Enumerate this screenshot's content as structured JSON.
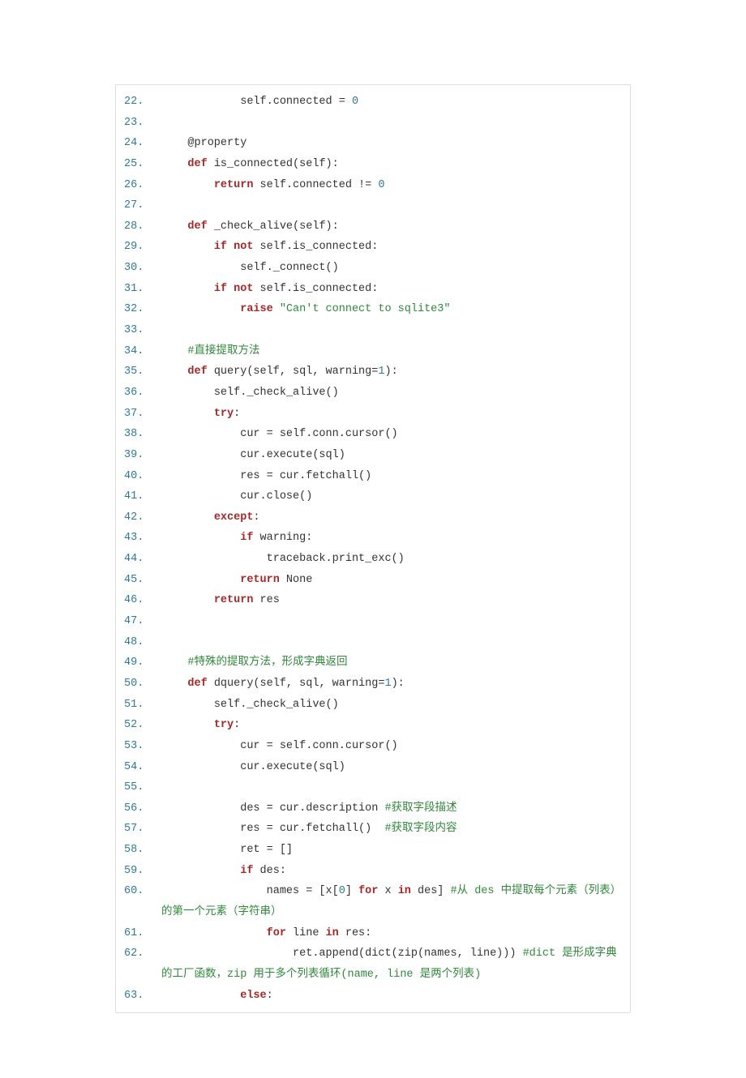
{
  "code": {
    "start": 22,
    "lines": [
      {
        "n": 22,
        "segs": [
          {
            "t": "            self.connected = "
          },
          {
            "t": "0",
            "c": "num"
          }
        ]
      },
      {
        "n": 23,
        "segs": []
      },
      {
        "n": 24,
        "segs": [
          {
            "t": "    @property"
          }
        ]
      },
      {
        "n": 25,
        "segs": [
          {
            "t": "    "
          },
          {
            "t": "def",
            "c": "kw"
          },
          {
            "t": " is_connected(self):"
          }
        ]
      },
      {
        "n": 26,
        "segs": [
          {
            "t": "        "
          },
          {
            "t": "return",
            "c": "kw"
          },
          {
            "t": " self.connected != "
          },
          {
            "t": "0",
            "c": "num"
          }
        ]
      },
      {
        "n": 27,
        "segs": []
      },
      {
        "n": 28,
        "segs": [
          {
            "t": "    "
          },
          {
            "t": "def",
            "c": "kw"
          },
          {
            "t": " _check_alive(self):"
          }
        ]
      },
      {
        "n": 29,
        "segs": [
          {
            "t": "        "
          },
          {
            "t": "if",
            "c": "kw"
          },
          {
            "t": " "
          },
          {
            "t": "not",
            "c": "kw"
          },
          {
            "t": " self.is_connected:"
          }
        ]
      },
      {
        "n": 30,
        "segs": [
          {
            "t": "            self._connect()"
          }
        ]
      },
      {
        "n": 31,
        "segs": [
          {
            "t": "        "
          },
          {
            "t": "if",
            "c": "kw"
          },
          {
            "t": " "
          },
          {
            "t": "not",
            "c": "kw"
          },
          {
            "t": " self.is_connected:"
          }
        ]
      },
      {
        "n": 32,
        "segs": [
          {
            "t": "            "
          },
          {
            "t": "raise",
            "c": "kw"
          },
          {
            "t": " "
          },
          {
            "t": "\"Can't connect to sqlite3\"",
            "c": "str"
          }
        ]
      },
      {
        "n": 33,
        "segs": []
      },
      {
        "n": 34,
        "segs": [
          {
            "t": "    "
          },
          {
            "t": "#直接提取方法",
            "c": "cm"
          }
        ]
      },
      {
        "n": 35,
        "segs": [
          {
            "t": "    "
          },
          {
            "t": "def",
            "c": "kw"
          },
          {
            "t": " query(self, sql, warning="
          },
          {
            "t": "1",
            "c": "num"
          },
          {
            "t": "):"
          }
        ]
      },
      {
        "n": 36,
        "segs": [
          {
            "t": "        self._check_alive()"
          }
        ]
      },
      {
        "n": 37,
        "segs": [
          {
            "t": "        "
          },
          {
            "t": "try",
            "c": "kw"
          },
          {
            "t": ":"
          }
        ]
      },
      {
        "n": 38,
        "segs": [
          {
            "t": "            cur = self.conn.cursor()"
          }
        ]
      },
      {
        "n": 39,
        "segs": [
          {
            "t": "            cur.execute(sql)"
          }
        ]
      },
      {
        "n": 40,
        "segs": [
          {
            "t": "            res = cur.fetchall()"
          }
        ]
      },
      {
        "n": 41,
        "segs": [
          {
            "t": "            cur.close()"
          }
        ]
      },
      {
        "n": 42,
        "segs": [
          {
            "t": "        "
          },
          {
            "t": "except",
            "c": "kw"
          },
          {
            "t": ":"
          }
        ]
      },
      {
        "n": 43,
        "segs": [
          {
            "t": "            "
          },
          {
            "t": "if",
            "c": "kw"
          },
          {
            "t": " warning:"
          }
        ]
      },
      {
        "n": 44,
        "segs": [
          {
            "t": "                traceback.print_exc()"
          }
        ]
      },
      {
        "n": 45,
        "segs": [
          {
            "t": "            "
          },
          {
            "t": "return",
            "c": "kw"
          },
          {
            "t": " None"
          }
        ]
      },
      {
        "n": 46,
        "segs": [
          {
            "t": "        "
          },
          {
            "t": "return",
            "c": "kw"
          },
          {
            "t": " res"
          }
        ]
      },
      {
        "n": 47,
        "segs": []
      },
      {
        "n": 48,
        "segs": []
      },
      {
        "n": 49,
        "segs": [
          {
            "t": "    "
          },
          {
            "t": "#特殊的提取方法，形成字典返回",
            "c": "cm"
          }
        ]
      },
      {
        "n": 50,
        "segs": [
          {
            "t": "    "
          },
          {
            "t": "def",
            "c": "kw"
          },
          {
            "t": " dquery(self, sql, warning="
          },
          {
            "t": "1",
            "c": "num"
          },
          {
            "t": "):"
          }
        ]
      },
      {
        "n": 51,
        "segs": [
          {
            "t": "        self._check_alive()"
          }
        ]
      },
      {
        "n": 52,
        "segs": [
          {
            "t": "        "
          },
          {
            "t": "try",
            "c": "kw"
          },
          {
            "t": ":"
          }
        ]
      },
      {
        "n": 53,
        "segs": [
          {
            "t": "            cur = self.conn.cursor()"
          }
        ]
      },
      {
        "n": 54,
        "segs": [
          {
            "t": "            cur.execute(sql)"
          }
        ]
      },
      {
        "n": 55,
        "segs": []
      },
      {
        "n": 56,
        "segs": [
          {
            "t": "            des = cur.description "
          },
          {
            "t": "#获取字段描述",
            "c": "cm"
          }
        ]
      },
      {
        "n": 57,
        "segs": [
          {
            "t": "            res = cur.fetchall()  "
          },
          {
            "t": "#获取字段内容",
            "c": "cm"
          }
        ]
      },
      {
        "n": 58,
        "segs": [
          {
            "t": "            ret = []"
          }
        ]
      },
      {
        "n": 59,
        "segs": [
          {
            "t": "            "
          },
          {
            "t": "if",
            "c": "kw"
          },
          {
            "t": " des:"
          }
        ]
      },
      {
        "n": 60,
        "segs": [
          {
            "t": "                names = [x["
          },
          {
            "t": "0",
            "c": "num"
          },
          {
            "t": "] "
          },
          {
            "t": "for",
            "c": "kw"
          },
          {
            "t": " x "
          },
          {
            "t": "in",
            "c": "kw"
          },
          {
            "t": " des] "
          },
          {
            "t": "#从 des 中提取每个元素（列表）的第一个元素（字符串）",
            "c": "cm"
          }
        ]
      },
      {
        "n": 61,
        "segs": [
          {
            "t": "                "
          },
          {
            "t": "for",
            "c": "kw"
          },
          {
            "t": " line "
          },
          {
            "t": "in",
            "c": "kw"
          },
          {
            "t": " res:"
          }
        ]
      },
      {
        "n": 62,
        "segs": [
          {
            "t": "                    ret.append(dict(zip(names, line))) "
          },
          {
            "t": "#dict 是形成字典的工厂函数，zip 用于多个列表循环(name, line 是两个列表)",
            "c": "cm"
          }
        ]
      },
      {
        "n": 63,
        "segs": [
          {
            "t": "            "
          },
          {
            "t": "else",
            "c": "kw"
          },
          {
            "t": ":"
          }
        ]
      }
    ]
  }
}
